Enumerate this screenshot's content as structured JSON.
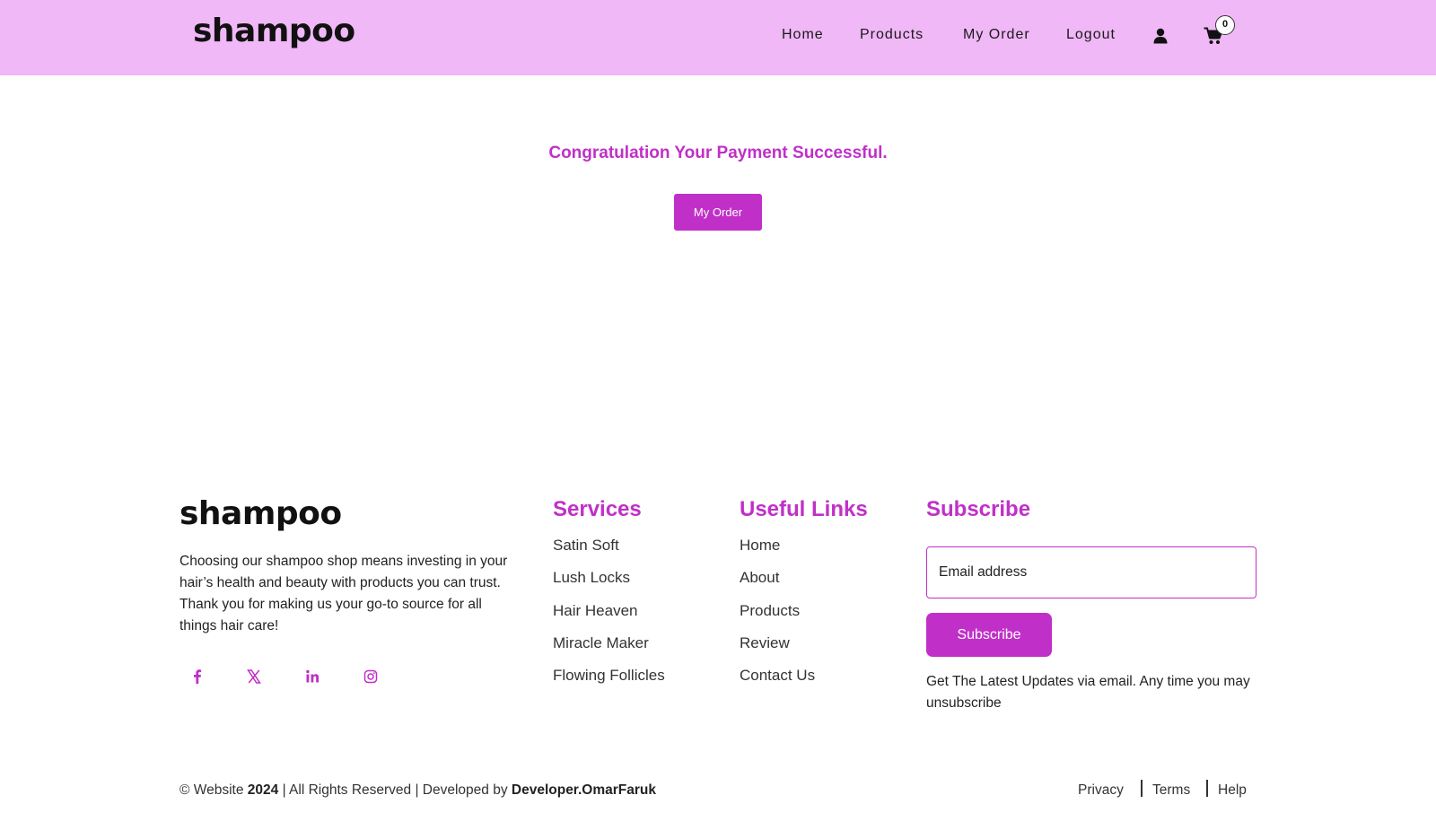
{
  "header": {
    "logo": "shampoo",
    "nav": [
      "Home",
      "Products",
      "My Order",
      "Logout"
    ],
    "cart_count": "0"
  },
  "main": {
    "message": "Congratulation Your Payment Successful.",
    "button": "My Order"
  },
  "footer": {
    "logo": "shampoo",
    "about": "Choosing our shampoo shop means investing in your hair’s health and beauty with products you can trust. Thank you for making us your go-to source for all things hair care!",
    "social": [
      "facebook-icon",
      "x-twitter-icon",
      "linkedin-icon",
      "instagram-icon"
    ],
    "services": {
      "title": "Services",
      "links": [
        "Satin Soft",
        "Lush Locks",
        "Hair Heaven",
        "Miracle Maker",
        "Flowing Follicles"
      ]
    },
    "useful": {
      "title": "Useful Links",
      "links": [
        "Home",
        "About",
        "Products",
        "Review",
        "Contact Us"
      ]
    },
    "subscribe": {
      "title": "Subscribe",
      "placeholder": "Email address",
      "button": "Subscribe",
      "note": "Get The Latest Updates via email. Any time you may unsubscribe"
    },
    "copyright": {
      "prefix": "© Website",
      "year": "2024",
      "middle": "| All Rights Reserved | Developed by",
      "developer": "Developer.OmarFaruk"
    },
    "legal": [
      "Privacy",
      "Terms",
      "Help"
    ]
  },
  "colors": {
    "header_bg": "#f0b8f6",
    "accent": "#c030c8"
  }
}
